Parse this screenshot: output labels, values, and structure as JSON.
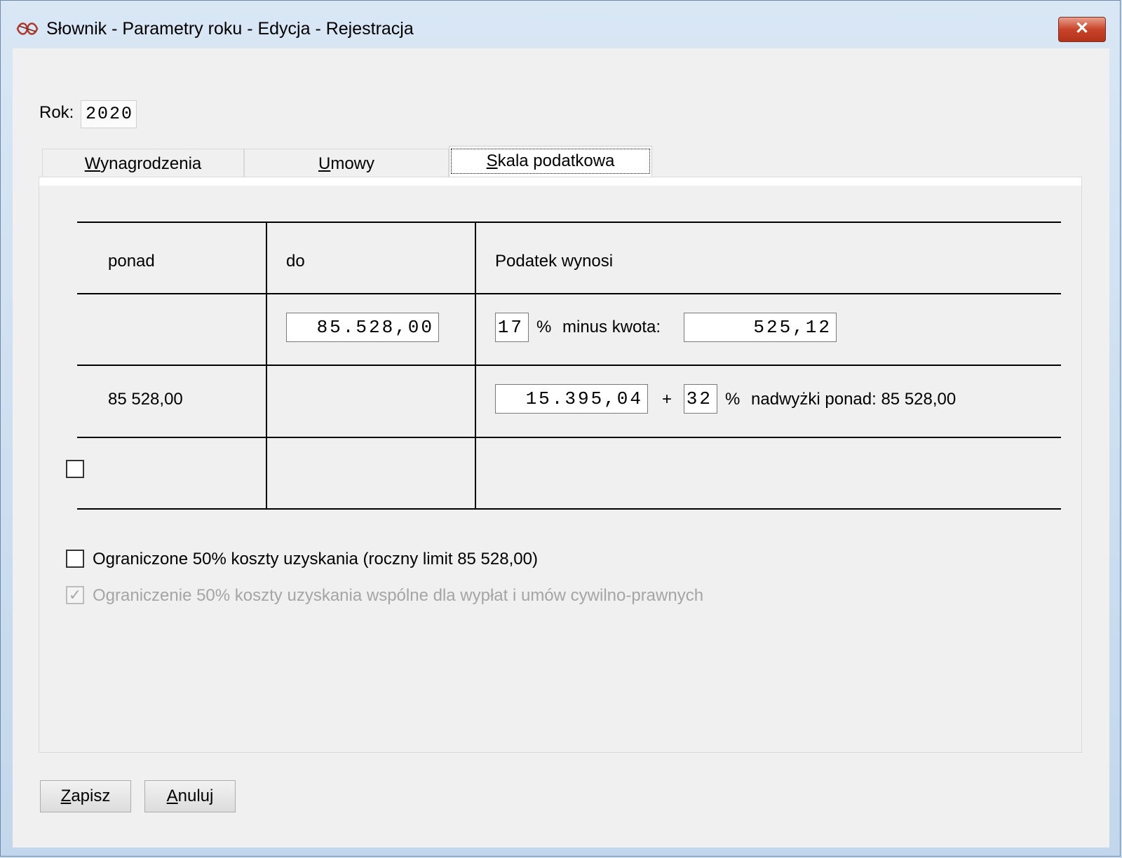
{
  "window": {
    "title": "Słownik - Parametry roku - Edycja - Rejestracja",
    "close_label": "✕"
  },
  "rok": {
    "label": "Rok:",
    "value": "2020"
  },
  "tabs": [
    {
      "label": "Wynagrodzenia",
      "accel": "W",
      "rest": "ynagrodzenia",
      "active": false
    },
    {
      "label": "Umowy",
      "accel": "U",
      "rest": "mowy",
      "active": false
    },
    {
      "label": "Skala podatkowa",
      "accel": "S",
      "rest": "kala podatkowa",
      "active": true
    }
  ],
  "table": {
    "headers": [
      "ponad",
      "do",
      "Podatek wynosi"
    ],
    "row1": {
      "do_value": "85.528,00",
      "percent": "17",
      "percent_sign": "%",
      "minus_label": "minus kwota:",
      "minus_value": "525,12"
    },
    "row2": {
      "ponad_value": "85 528,00",
      "base_value": "15.395,04",
      "plus_sign": "+",
      "percent": "32",
      "percent_sign": "%",
      "excess_label": "nadwyżki ponad: 85 528,00"
    },
    "row3": {
      "checked": false
    }
  },
  "options": [
    {
      "label": "Ograniczone 50% koszty uzyskania (roczny limit 85 528,00)",
      "checked": false,
      "enabled": true
    },
    {
      "label": "Ograniczenie 50% koszty uzyskania wspólne dla wypłat i umów cywilno-prawnych",
      "checked": true,
      "enabled": false
    }
  ],
  "buttons": {
    "save": {
      "accel": "Z",
      "rest": "apisz"
    },
    "cancel": {
      "accel": "A",
      "rest": "nuluj"
    }
  }
}
